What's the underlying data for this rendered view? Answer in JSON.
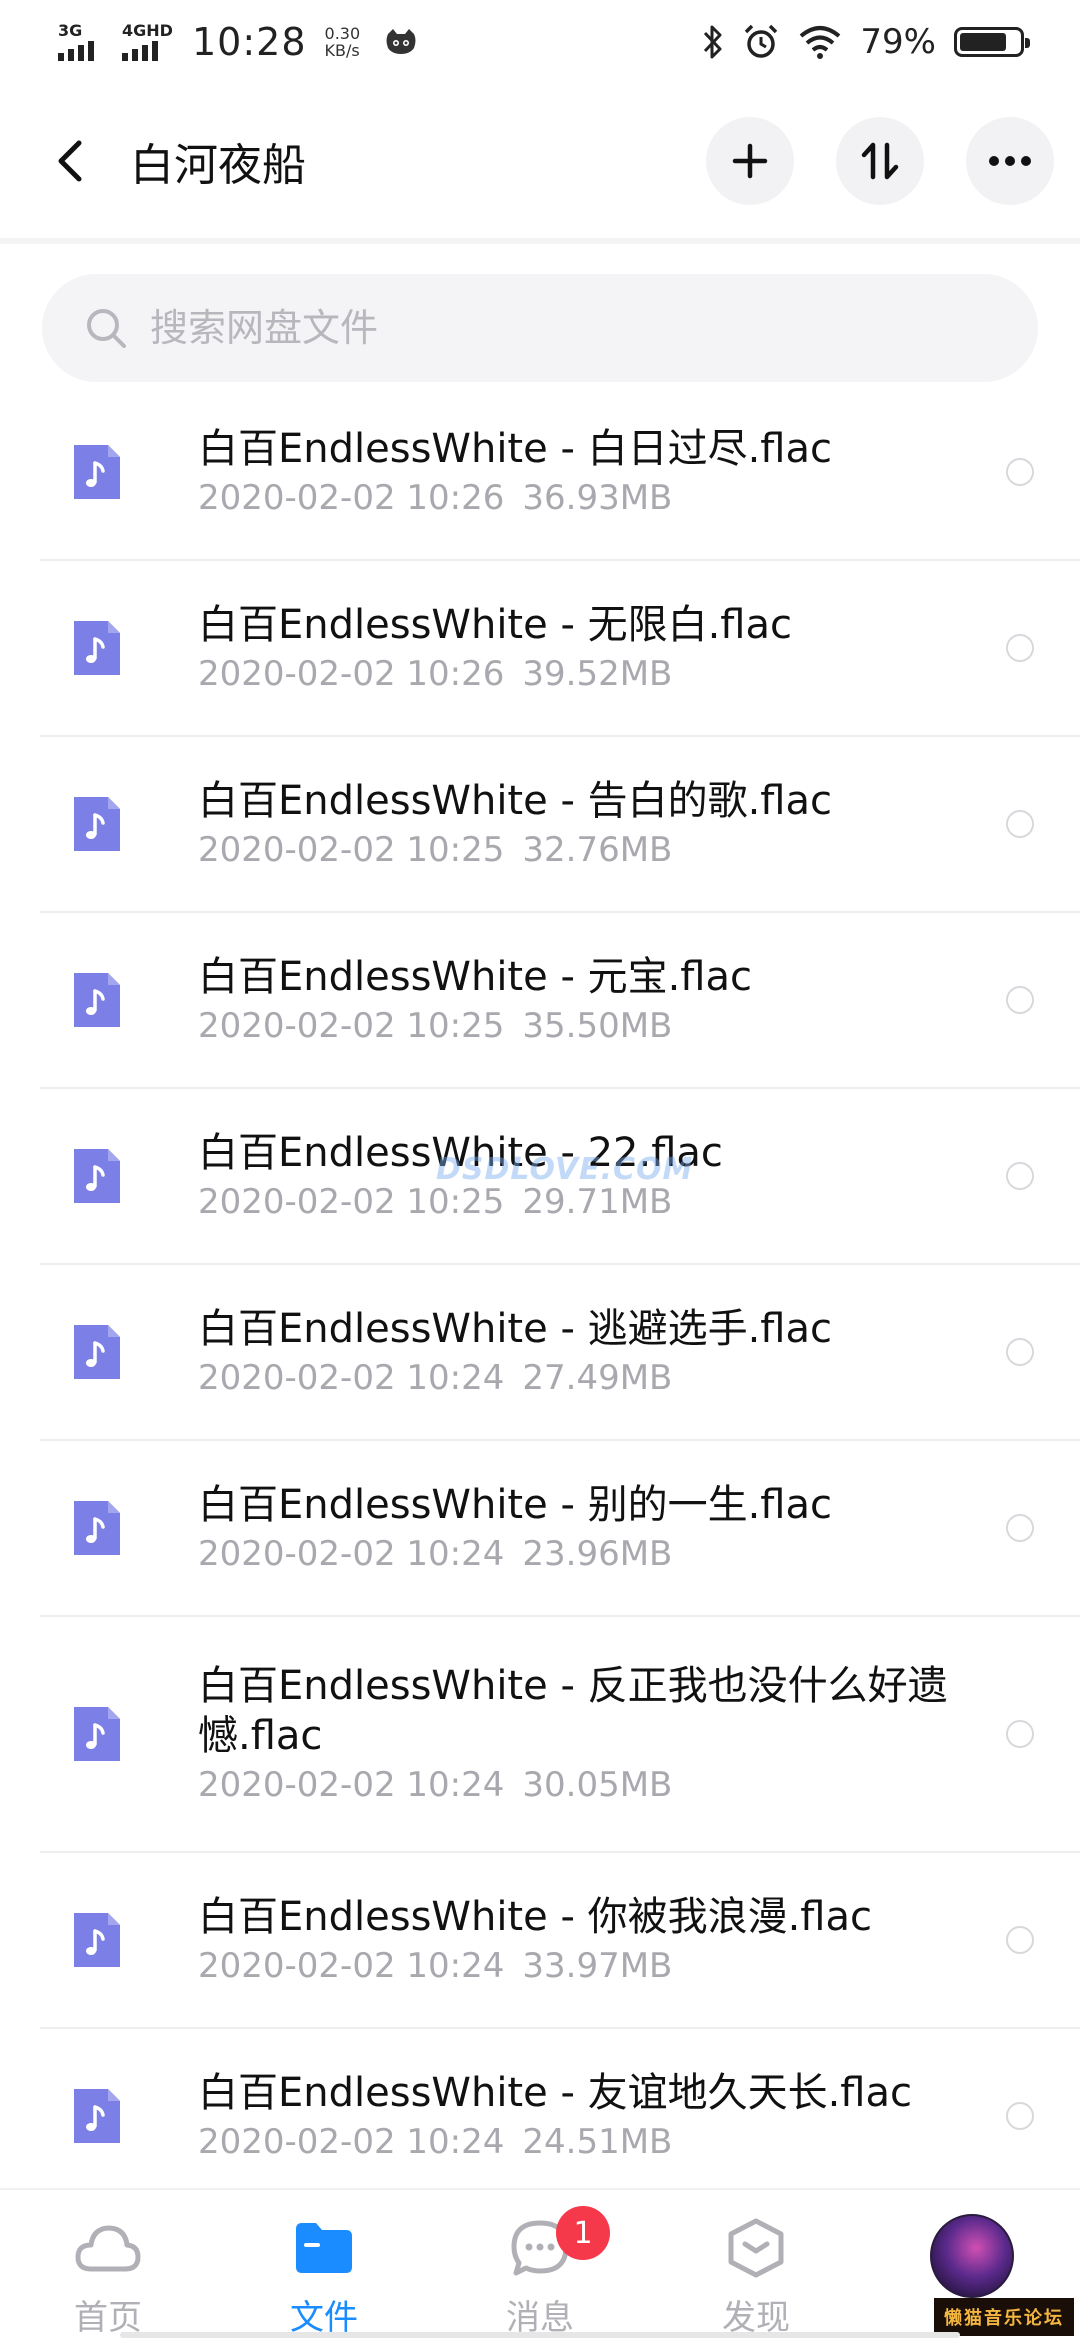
{
  "status_bar": {
    "sim1": "3G",
    "sim2": "4GHD",
    "time": "10:28",
    "speed_value": "0.30",
    "speed_unit": "KB/s",
    "battery_pct": "79%",
    "battery_level": 0.79
  },
  "header": {
    "title": "白河夜船",
    "back_icon": "chevron-left-icon",
    "actions": [
      "plus-icon",
      "sort-icon",
      "more-icon"
    ]
  },
  "search": {
    "placeholder": "搜索网盘文件"
  },
  "files": [
    {
      "name": "白百EndlessWhite - 白日过尽.flac",
      "date": "2020-02-02  10:26",
      "size": "36.93MB"
    },
    {
      "name": "白百EndlessWhite - 无限白.flac",
      "date": "2020-02-02  10:26",
      "size": "39.52MB"
    },
    {
      "name": "白百EndlessWhite - 告白的歌.flac",
      "date": "2020-02-02  10:25",
      "size": "32.76MB"
    },
    {
      "name": "白百EndlessWhite - 元宝.flac",
      "date": "2020-02-02  10:25",
      "size": "35.50MB"
    },
    {
      "name": "白百EndlessWhite - 22.flac",
      "date": "2020-02-02  10:25",
      "size": "29.71MB"
    },
    {
      "name": "白百EndlessWhite - 逃避选手.flac",
      "date": "2020-02-02  10:24",
      "size": "27.49MB"
    },
    {
      "name": "白百EndlessWhite - 别的一生.flac",
      "date": "2020-02-02  10:24",
      "size": "23.96MB"
    },
    {
      "name": "白百EndlessWhite - 反正我也没什么好遗憾.flac",
      "date": "2020-02-02  10:24",
      "size": "30.05MB"
    },
    {
      "name": "白百EndlessWhite - 你被我浪漫.flac",
      "date": "2020-02-02  10:24",
      "size": "33.97MB"
    },
    {
      "name": "白百EndlessWhite - 友谊地久天长.flac",
      "date": "2020-02-02  10:24",
      "size": "24.51MB"
    }
  ],
  "watermark": "DSDLOVE.COM",
  "bottom_nav": {
    "tabs": [
      {
        "label": "首页",
        "icon": "cloud-icon"
      },
      {
        "label": "文件",
        "icon": "folder-icon"
      },
      {
        "label": "消息",
        "icon": "chat-icon",
        "badge": "1"
      },
      {
        "label": "发现",
        "icon": "discover-icon"
      }
    ],
    "active_color": "#1a8cff",
    "stamp": "懒猫音乐论坛"
  },
  "colors": {
    "file_icon": "#7b7fe6",
    "accent": "#1a8cff",
    "badge": "#f5394b"
  }
}
